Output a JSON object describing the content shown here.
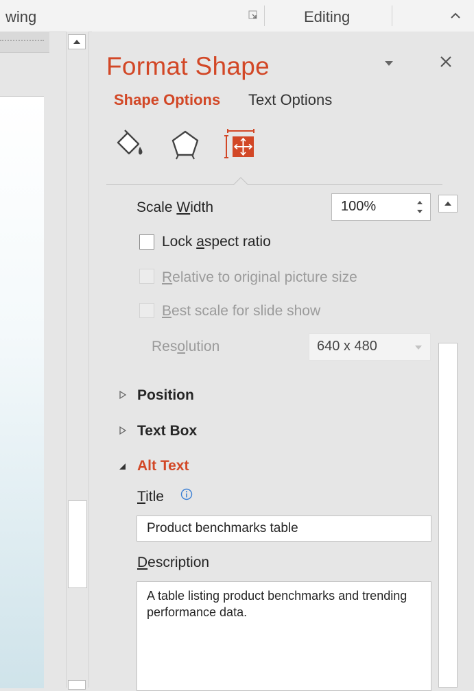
{
  "ribbon": {
    "group_left_label": "wing",
    "group_right_label": "Editing"
  },
  "pane": {
    "title": "Format Shape",
    "tabs": {
      "shape_options": "Shape Options",
      "text_options": "Text Options"
    },
    "icons": [
      "fill-line-icon",
      "effects-pentagon-icon",
      "size-properties-icon"
    ]
  },
  "size": {
    "scale_width": {
      "label_before": "Scale ",
      "label_access": "W",
      "label_after": "idth",
      "value": "100%"
    },
    "lock_aspect": {
      "label_before": "Lock ",
      "label_access": "a",
      "label_after": "spect ratio",
      "checked": false
    },
    "relative_size": {
      "label_before": "",
      "label_access": "R",
      "label_after": "elative to original picture size",
      "checked": false,
      "disabled": true
    },
    "best_scale": {
      "label_before": "",
      "label_access": "B",
      "label_after": "est scale for slide show",
      "checked": false,
      "disabled": true
    },
    "resolution": {
      "label_before": "Res",
      "label_access": "o",
      "label_after": "lution",
      "value": "640 x 480",
      "disabled": true
    }
  },
  "sections": {
    "position": "Position",
    "text_box": "Text Box",
    "alt_text": "Alt Text"
  },
  "alt_text": {
    "title_label_access": "T",
    "title_label_after": "itle",
    "title_value": "Product benchmarks table",
    "description_label_access": "D",
    "description_label_after": "escription",
    "description_value": "A table listing product benchmarks and trending performance data."
  },
  "colors": {
    "accent": "#d24726",
    "pane_bg": "#e6e6e6",
    "disabled_text": "#9b9b9b"
  }
}
